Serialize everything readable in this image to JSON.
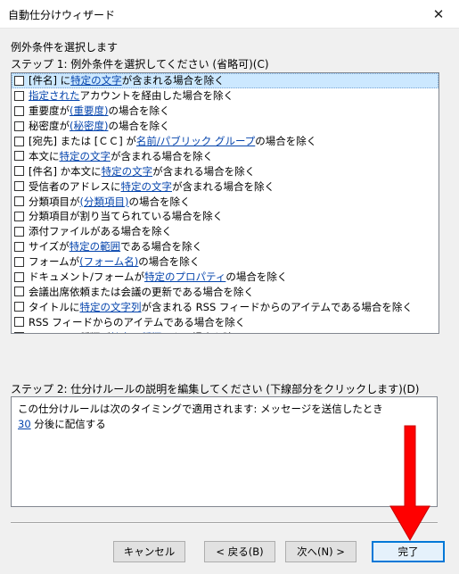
{
  "window": {
    "title": "自動仕分けウィザード"
  },
  "header": {
    "text": "例外条件を選択します"
  },
  "step1": {
    "label": "ステップ 1: 例外条件を選択してください (省略可)(C)",
    "conditions": [
      {
        "segments": [
          {
            "t": "[件名] に "
          },
          {
            "t": "特定の文字",
            "link": true
          },
          {
            "t": " が含まれる場合を除く"
          }
        ]
      },
      {
        "segments": [
          {
            "t": "指定された",
            "link": true
          },
          {
            "t": " アカウントを経由した場合を除く"
          }
        ]
      },
      {
        "segments": [
          {
            "t": "重要度が "
          },
          {
            "t": "(重要度)",
            "link": true
          },
          {
            "t": " の場合を除く"
          }
        ]
      },
      {
        "segments": [
          {
            "t": "秘密度が "
          },
          {
            "t": "(秘密度)",
            "link": true
          },
          {
            "t": " の場合を除く"
          }
        ]
      },
      {
        "segments": [
          {
            "t": "[宛先] または [ＣＣ] が "
          },
          {
            "t": "名前/パブリック グループ",
            "link": true
          },
          {
            "t": " の場合を除く"
          }
        ]
      },
      {
        "segments": [
          {
            "t": "本文に "
          },
          {
            "t": "特定の文字",
            "link": true
          },
          {
            "t": " が含まれる場合を除く"
          }
        ]
      },
      {
        "segments": [
          {
            "t": "[件名] か本文に "
          },
          {
            "t": "特定の文字",
            "link": true
          },
          {
            "t": " が含まれる場合を除く"
          }
        ]
      },
      {
        "segments": [
          {
            "t": "受信者のアドレスに "
          },
          {
            "t": "特定の文字",
            "link": true
          },
          {
            "t": " が含まれる場合を除く"
          }
        ]
      },
      {
        "segments": [
          {
            "t": "分類項目が "
          },
          {
            "t": "(分類項目)",
            "link": true
          },
          {
            "t": " の場合を除く"
          }
        ]
      },
      {
        "segments": [
          {
            "t": "分類項目が割り当てられている場合を除く"
          }
        ]
      },
      {
        "segments": [
          {
            "t": "添付ファイルがある場合を除く"
          }
        ]
      },
      {
        "segments": [
          {
            "t": "サイズが "
          },
          {
            "t": "特定の範囲",
            "link": true
          },
          {
            "t": " である場合を除く"
          }
        ]
      },
      {
        "segments": [
          {
            "t": "フォームが "
          },
          {
            "t": "(フォーム名)",
            "link": true
          },
          {
            "t": " の場合を除く"
          }
        ]
      },
      {
        "segments": [
          {
            "t": "ドキュメント/フォームが "
          },
          {
            "t": "特定のプロパティ",
            "link": true
          },
          {
            "t": " の場合を除く"
          }
        ]
      },
      {
        "segments": [
          {
            "t": "会議出席依頼または会議の更新である場合を除く"
          }
        ]
      },
      {
        "segments": [
          {
            "t": "タイトルに "
          },
          {
            "t": "特定の文字列",
            "link": true
          },
          {
            "t": " が含まれる RSS フィードからのアイテムである場合を除く"
          }
        ]
      },
      {
        "segments": [
          {
            "t": "RSS フィードからのアイテムである場合を除く"
          }
        ]
      },
      {
        "segments": [
          {
            "t": "フォームの種類が "
          },
          {
            "t": "特定の種類",
            "link": true
          },
          {
            "t": " である場合を除く"
          }
        ]
      }
    ]
  },
  "step2": {
    "label": "ステップ 2: 仕分けルールの説明を編集してください (下線部分をクリックします)(D)",
    "line1": "この仕分けルールは次のタイミングで適用されます: メッセージを送信したとき",
    "line2_link": "30",
    "line2_text": " 分後に配信する"
  },
  "buttons": {
    "cancel": "キャンセル",
    "back": "< 戻る(B)",
    "next": "次へ(N) >",
    "finish": "完了"
  },
  "colors": {
    "link": "#0645ad",
    "selection": "#cce8ff",
    "arrow": "#ff0000"
  },
  "icons": {
    "close": "close-icon",
    "annotation": "red-arrow-annotation"
  }
}
